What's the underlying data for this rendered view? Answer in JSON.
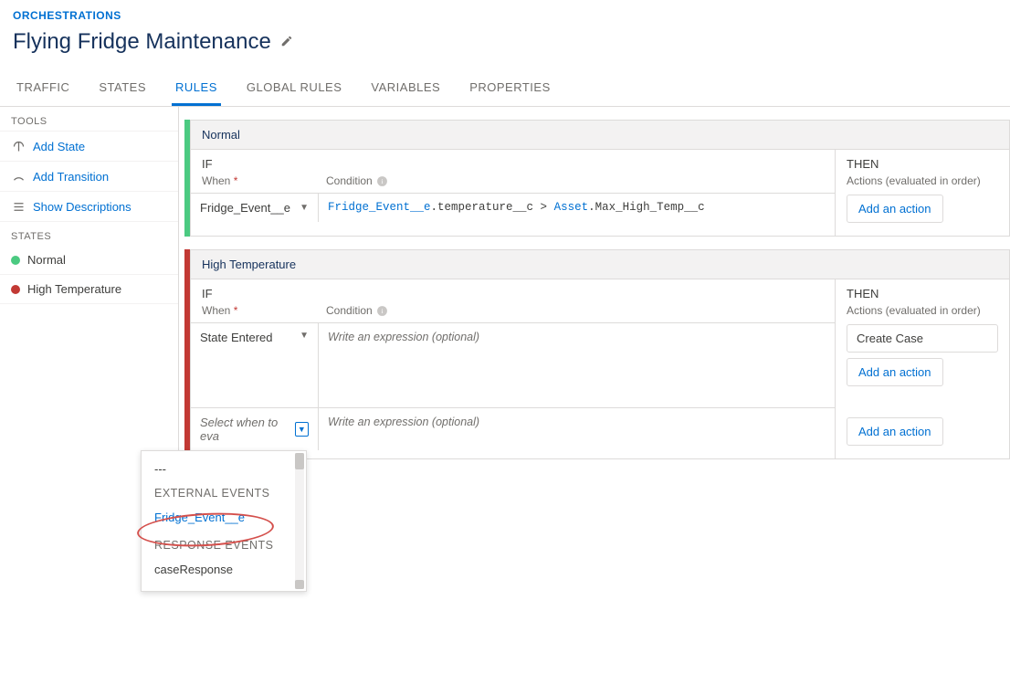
{
  "header": {
    "breadcrumb": "ORCHESTRATIONS",
    "title": "Flying Fridge Maintenance"
  },
  "tabs": [
    {
      "label": "TRAFFIC",
      "active": false
    },
    {
      "label": "STATES",
      "active": false
    },
    {
      "label": "RULES",
      "active": true
    },
    {
      "label": "GLOBAL RULES",
      "active": false
    },
    {
      "label": "VARIABLES",
      "active": false
    },
    {
      "label": "PROPERTIES",
      "active": false
    }
  ],
  "sidebar": {
    "tools_label": "TOOLS",
    "tools": [
      {
        "label": "Add State",
        "icon": "plus-circle"
      },
      {
        "label": "Add Transition",
        "icon": "arc"
      },
      {
        "label": "Show Descriptions",
        "icon": "list"
      }
    ],
    "states_label": "STATES",
    "states": [
      {
        "label": "Normal",
        "color": "green"
      },
      {
        "label": "High Temperature",
        "color": "red"
      }
    ]
  },
  "rules": [
    {
      "title": "Normal",
      "stripe": "green",
      "if_label": "IF",
      "when_label": "When",
      "cond_label": "Condition",
      "then_label": "THEN",
      "then_sub": "Actions (evaluated in order)",
      "rows": [
        {
          "when": "Fridge_Event__e",
          "when_placeholder": false,
          "condition_tokens": [
            {
              "t": "Fridge_Event__e",
              "c": "blue"
            },
            {
              "t": ".temperature__c > ",
              "c": "plain"
            },
            {
              "t": "Asset",
              "c": "blue"
            },
            {
              "t": ".Max_High_Temp__c",
              "c": "plain"
            }
          ],
          "condition_placeholder": false
        }
      ],
      "actions": [],
      "add_action": "Add an action"
    },
    {
      "title": "High Temperature",
      "stripe": "red",
      "if_label": "IF",
      "when_label": "When",
      "cond_label": "Condition",
      "then_label": "THEN",
      "then_sub": "Actions (evaluated in order)",
      "rows": [
        {
          "when": "State Entered",
          "when_placeholder": false,
          "condition_placeholder": true,
          "condition_ph_text": "Write an expression (optional)"
        },
        {
          "when": "Select when to eva",
          "when_placeholder": true,
          "dropdown_open": true,
          "condition_placeholder": true,
          "condition_ph_text": "Write an expression (optional)"
        }
      ],
      "actions": [
        "Create Case"
      ],
      "add_action": "Add an action"
    }
  ],
  "dropdown": {
    "sep": "---",
    "heading1": "EXTERNAL EVENTS",
    "item1": "Fridge_Event__e",
    "heading2": "RESPONSE EVENTS",
    "item2": "caseResponse"
  }
}
